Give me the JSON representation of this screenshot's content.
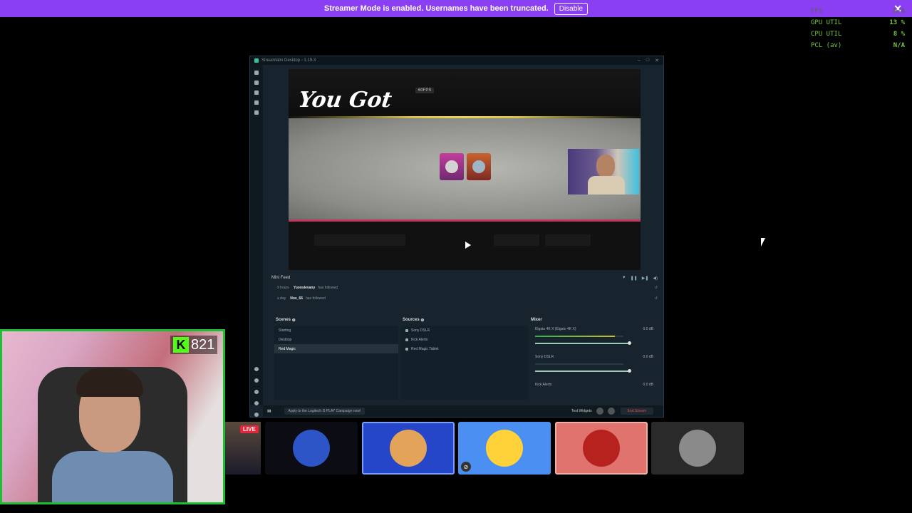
{
  "banner": {
    "message": "Streamer Mode is enabled. Usernames have been truncated.",
    "disable_label": "Disable",
    "close_glyph": "✕",
    "color": "#8b3ff2"
  },
  "overlay_stats": [
    {
      "label": "FPS",
      "value": "N/A",
      "dim": true
    },
    {
      "label": "GPU UTIL",
      "value": "13 %",
      "dim": false
    },
    {
      "label": "CPU UTIL",
      "value": "8 %",
      "dim": false
    },
    {
      "label": "PCL (av)",
      "value": "N/A",
      "dim": false
    }
  ],
  "window": {
    "title": "Streamlabs Desktop - 1.19.3",
    "controls": [
      "–",
      "□",
      "✕"
    ],
    "preview": {
      "headline": "You Got",
      "fps_badge": "60FPS"
    },
    "mini_feed": {
      "title": "Mini Feed",
      "items": [
        {
          "time": "9 hours",
          "user": "Yuonslevany",
          "action": "has followed"
        },
        {
          "time": "a day",
          "user": "Nos_66",
          "action": "has followed"
        }
      ]
    },
    "scenes": {
      "title": "Scenes",
      "items": [
        "Starting",
        "Desktop",
        "Red Magic"
      ],
      "selected_index": 2
    },
    "sources": {
      "title": "Sources",
      "items": [
        "Sony DSLR",
        "Kick Alerts",
        "Red Magic Tablet"
      ]
    },
    "mixer": {
      "title": "Mixer",
      "channels": [
        {
          "name": "Elgato 4K X (Elgato 4K X)",
          "db": "0.0 dB",
          "level": 0.9
        },
        {
          "name": "Sony DSLR",
          "db": "0.0 dB",
          "level": 0.0
        },
        {
          "name": "Kick Alerts",
          "db": "0.0 dB",
          "level": 0.0
        }
      ]
    },
    "status": {
      "promo": "Apply to the Logitech G PLAY Campaign now!",
      "test_widgets": "Test Widgets",
      "end_stream": "End Stream"
    }
  },
  "kick_badge": {
    "letter": "K",
    "count": "821",
    "color": "#53fc18"
  },
  "live_badge": "LIVE",
  "participants": [
    {
      "name": "participant-sanjo",
      "bg": "#0c0c14",
      "avatar": "#2d55c7",
      "border": "none",
      "mic_muted": false
    },
    {
      "name": "participant-bearded",
      "bg": "#2546c9",
      "avatar": "#e3a45a",
      "border": "#7aa0ff",
      "mic_muted": false
    },
    {
      "name": "participant-cartoon",
      "bg": "#4c8ff2",
      "avatar": "#ffd23a",
      "border": "none",
      "mic_muted": true
    },
    {
      "name": "participant-red",
      "bg": "#e0736d",
      "avatar": "#b7221f",
      "border": "#f0b0a8",
      "mic_muted": false
    },
    {
      "name": "participant-bw",
      "bg": "#2a2a2a",
      "avatar": "#8a8a8a",
      "border": "none",
      "mic_muted": false
    }
  ]
}
